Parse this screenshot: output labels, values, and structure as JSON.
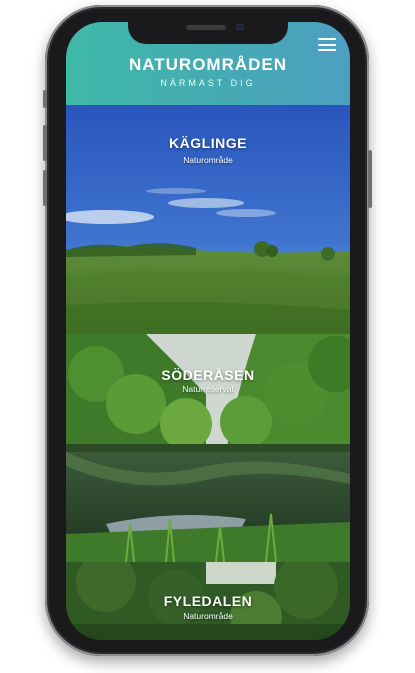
{
  "header": {
    "title": "NATUROMRÅDEN",
    "subtitle": "NÄRMAST DIG",
    "menu_icon": "hamburger-menu-icon"
  },
  "areas": [
    {
      "name": "KÄGLINGE",
      "type": "Naturområde"
    },
    {
      "name": "SÖDERÅSEN",
      "type": "Naturreservat"
    },
    {
      "name": "FYLEDALEN",
      "type": "Naturområde"
    }
  ],
  "colors": {
    "header_start": "#3fb9a8",
    "header_end": "#4d9fc2",
    "sky": "#2f5fc2",
    "grass": "#4f7d2e"
  }
}
